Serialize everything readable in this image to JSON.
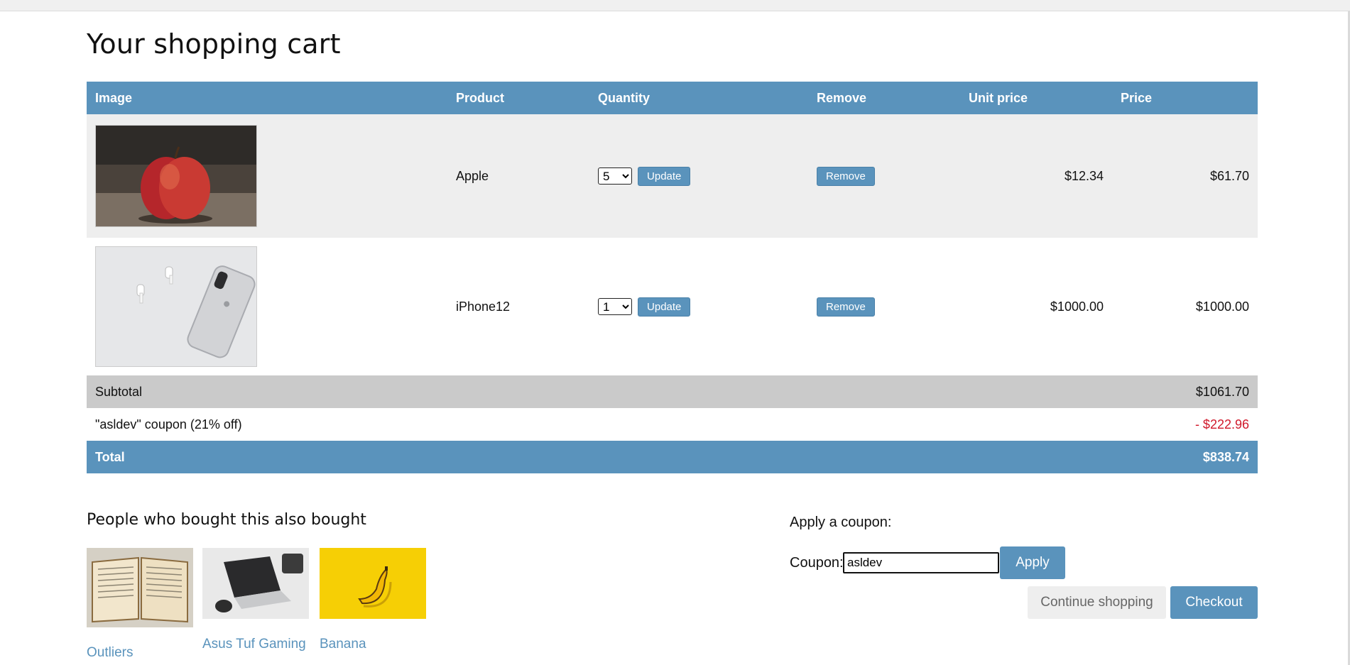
{
  "page": {
    "title": "Your shopping cart"
  },
  "table": {
    "headers": [
      "Image",
      "Product",
      "Quantity",
      "Remove",
      "Unit price",
      "Price"
    ],
    "rows": [
      {
        "product": "Apple",
        "quantity": "5",
        "update_label": "Update",
        "remove_label": "Remove",
        "unit_price": "$12.34",
        "price": "$61.70"
      },
      {
        "product": "iPhone12",
        "quantity": "1",
        "update_label": "Update",
        "remove_label": "Remove",
        "unit_price": "$1000.00",
        "price": "$1000.00"
      }
    ],
    "subtotal_label": "Subtotal",
    "subtotal_value": "$1061.70",
    "coupon_label": "\"asldev\" coupon (21% off)",
    "coupon_value": "- $222.96",
    "total_label": "Total",
    "total_value": "$838.74"
  },
  "recommendations": {
    "title": "People who bought this also bought",
    "items": [
      {
        "label": "Outliers"
      },
      {
        "label": "Asus Tuf Gaming"
      },
      {
        "label": "Banana"
      }
    ]
  },
  "coupon_form": {
    "title": "Apply a coupon:",
    "label": "Coupon:",
    "value": "asldev",
    "apply_label": "Apply"
  },
  "actions": {
    "continue_label": "Continue shopping",
    "checkout_label": "Checkout"
  },
  "colors": {
    "accent": "#5a93bc",
    "row_alt": "#eeeeee",
    "subtotal_bg": "#cacaca",
    "discount": "#d0192b"
  }
}
